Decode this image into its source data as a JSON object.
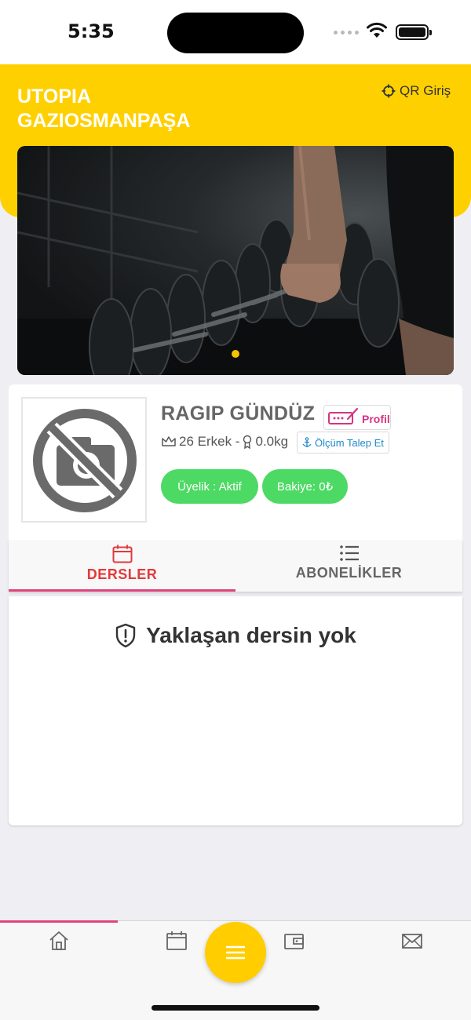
{
  "status_bar": {
    "time": "5:35"
  },
  "header": {
    "gym_name_line1": "UTOPIA",
    "gym_name_line2": "GAZIOSMANPAŞA",
    "qr_label": "QR Giriş"
  },
  "banner": {
    "slide_count": 1,
    "active_slide": 1
  },
  "profile": {
    "name": "RAGIP GÜNDÜZ",
    "profile_label": "Profil",
    "age_gender": "26 Erkek -",
    "weight": "0.0kg",
    "measure_label": "Ölçüm Talep Et",
    "membership_status": "Üyelik : Aktif",
    "balance": "Bakiye: 0₺"
  },
  "tabs": [
    {
      "label": "DERSLER",
      "icon": "calendar-icon",
      "active": true
    },
    {
      "label": "ABONELİKLER",
      "icon": "list-icon",
      "active": false
    }
  ],
  "content": {
    "empty_message": "Yaklaşan dersin yok"
  },
  "bottom_nav": {
    "items": [
      "home-icon",
      "calendar-icon",
      "menu-icon",
      "wallet-icon",
      "mail-icon"
    ],
    "active_index": 0
  },
  "colors": {
    "brand_yellow": "#ffd000",
    "accent_pink": "#e0457b",
    "active_tab_red": "#e23a3a",
    "pill_green": "#4cd964",
    "link_blue": "#1e88c8"
  }
}
